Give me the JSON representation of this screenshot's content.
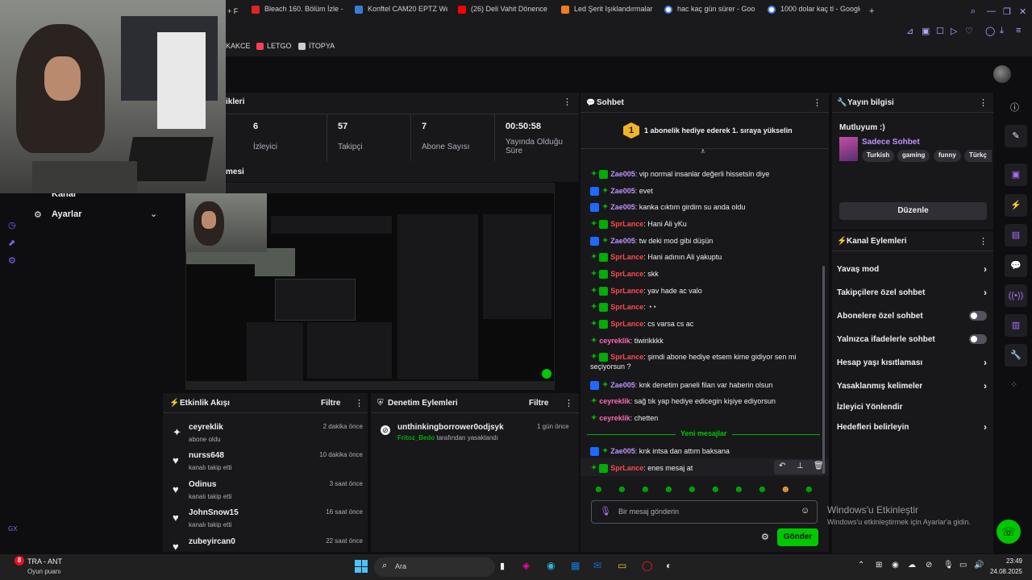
{
  "browser": {
    "tabs": [
      {
        "label": "Bleach 160. Bölüm İzle - ",
        "color": "#e02424"
      },
      {
        "label": "Konftel CAM20 EPTZ We",
        "color": "#3a7bd5"
      },
      {
        "label": "(26) Deli Vahit Dönence",
        "color": "#ff0000"
      },
      {
        "label": "Led Şerit Işıklandırmalar",
        "color": "#f07e1b"
      },
      {
        "label": "hac kaç gün sürer - Goo",
        "color": "#4285f4"
      },
      {
        "label": "1000 dolar kaç tl - Google",
        "color": "#4285f4"
      }
    ],
    "bookmarks": [
      {
        "label": "KAKCE",
        "color": "#555555"
      },
      {
        "label": "LETGO",
        "color": "#ff3f55"
      },
      {
        "label": "İTOPYA",
        "color": "#cccccc"
      }
    ]
  },
  "left": {
    "section_label": "Kanal",
    "settings_label": "Ayarlar",
    "gx_label": "GX"
  },
  "stats": {
    "title": "ikleri",
    "items": [
      {
        "value": "6",
        "label": "İzleyici"
      },
      {
        "value": "57",
        "label": "Takipçi"
      },
      {
        "value": "7",
        "label": "Abone Sayısı"
      },
      {
        "value": "00:50:58",
        "label": "Yayında Olduğu Süre"
      }
    ]
  },
  "preview": {
    "title": "mesi"
  },
  "activity": {
    "title": "Etkinlik Akışı",
    "filter": "Filtre",
    "items": [
      {
        "name": "ceyreklik",
        "sub": "abone oldu",
        "time": "2 dakika önce",
        "icon": "sparkle-icon"
      },
      {
        "name": "nurss648",
        "sub": "kanalı takip etti",
        "time": "10 dakika önce",
        "icon": "heart-icon"
      },
      {
        "name": "Odinus",
        "sub": "kanalı takip etti",
        "time": "3 saat önce",
        "icon": "heart-icon"
      },
      {
        "name": "JohnSnow15",
        "sub": "kanalı takip etti",
        "time": "16 saat önce",
        "icon": "heart-icon"
      },
      {
        "name": "zubeyircan0",
        "sub": "",
        "time": "22 saat önce",
        "icon": "heart-icon"
      }
    ]
  },
  "modactions": {
    "title": "Denetim Eylemleri",
    "filter": "Filtre",
    "item": {
      "name": "unthinkingborrower0odjsyk",
      "by": "Fritoz_Bedo",
      "rest": "tarafından yasaklandı",
      "time": "1 gün önce"
    }
  },
  "chat": {
    "title": "Sohbet",
    "banner": "1 abonelik hediye ederek 1. sıraya yükselin",
    "banner_num": "1",
    "messages": [
      {
        "user": "Zae005",
        "color": "purple",
        "text": "vip normal insanlar değerli hissetsin diye",
        "badges": [
          "mod",
          "green"
        ]
      },
      {
        "user": "Zae005",
        "color": "purple",
        "text": "evet",
        "badges": [
          "blue",
          "mod"
        ]
      },
      {
        "user": "Zae005",
        "color": "purple",
        "text": "kanka cıktım girdim su anda oldu",
        "badges": [
          "blue",
          "mod"
        ]
      },
      {
        "user": "SprLance",
        "color": "red",
        "text": "Hani Ali yKu",
        "badges": [
          "mod",
          "green"
        ]
      },
      {
        "user": "Zae005",
        "color": "purple",
        "text": "tw deki mod gibi düşün",
        "badges": [
          "blue",
          "mod"
        ]
      },
      {
        "user": "SprLance",
        "color": "red",
        "text": "Hani adının Ali yakuptu",
        "badges": [
          "mod",
          "green"
        ]
      },
      {
        "user": "SprLance",
        "color": "red",
        "text": "skk",
        "badges": [
          "mod",
          "green"
        ]
      },
      {
        "user": "SprLance",
        "color": "red",
        "text": "yav hade ac valo",
        "badges": [
          "mod",
          "green"
        ]
      },
      {
        "user": "SprLance",
        "color": "red",
        "text": "",
        "badges": [
          "mod",
          "green"
        ]
      },
      {
        "user": "SprLance",
        "color": "red",
        "text": "cs varsa cs ac",
        "badges": [
          "mod",
          "green"
        ]
      },
      {
        "user": "ceyreklik",
        "color": "pink",
        "text": "tiwirikkkk",
        "badges": [
          "mod"
        ]
      },
      {
        "user": "SprLance",
        "color": "red",
        "text": "şimdi abone hediye etsem kime gidiyor sen mi seçiyorsun ?",
        "badges": [
          "mod",
          "green"
        ]
      },
      {
        "user": "Zae005",
        "color": "purple",
        "text": "knk denetim paneli filan var haberin olsun",
        "badges": [
          "blue",
          "mod"
        ]
      },
      {
        "user": "ceyreklik",
        "color": "pink",
        "text": "sağ tık yap hediye edicegin kişiye ediyorsun",
        "badges": [
          "mod"
        ]
      },
      {
        "user": "ceyreklik",
        "color": "pink",
        "text": "chetten",
        "badges": [
          "mod"
        ]
      }
    ],
    "new_messages": "Yeni mesajlar",
    "after": [
      {
        "user": "Zae005",
        "color": "purple",
        "text": "knk intsa dan attım baksana",
        "badges": [
          "blue",
          "mod"
        ]
      },
      {
        "user": "SprLance",
        "color": "red",
        "text": "enes mesaj at",
        "badges": [
          "mod",
          "green"
        ]
      }
    ],
    "input_placeholder": "Bir mesaj gönderin",
    "send": "Gönder"
  },
  "streaminfo": {
    "title": "Yayın bilgisi",
    "stream_title": "Mutluyum :)",
    "category": "Sadece Sohbet",
    "tags": [
      "Turkish",
      "gaming",
      "funny",
      "Türkç"
    ],
    "edit": "Düzenle"
  },
  "chanactions": {
    "title": "Kanal Eylemleri",
    "rows": [
      {
        "label": "Yavaş mod",
        "type": "arrow"
      },
      {
        "label": "Takipçilere özel sohbet",
        "type": "arrow"
      },
      {
        "label": "Abonelere özel sohbet",
        "type": "toggle"
      },
      {
        "label": "Yalnızca ifadelerle sohbet",
        "type": "toggle"
      },
      {
        "label": "Hesap yaşı kısıtlaması",
        "type": "arrow"
      },
      {
        "label": "Yasaklanmış kelimeler",
        "type": "arrow"
      },
      {
        "label": "İzleyici Yönlendir",
        "type": "none"
      },
      {
        "label": "Hedefleri belirleyin",
        "type": "arrow"
      }
    ]
  },
  "watermark": {
    "line1": "Windows'u Etkinleştir",
    "line2": "Windows'u etkinleştirmek için Ayarlar'a gidin."
  },
  "taskbar": {
    "weather_badge": "8",
    "match": "TRA - ANT",
    "match_sub": "Oyun puanı",
    "search": "Ara",
    "time": "23:49",
    "date": "24.08.2025"
  }
}
